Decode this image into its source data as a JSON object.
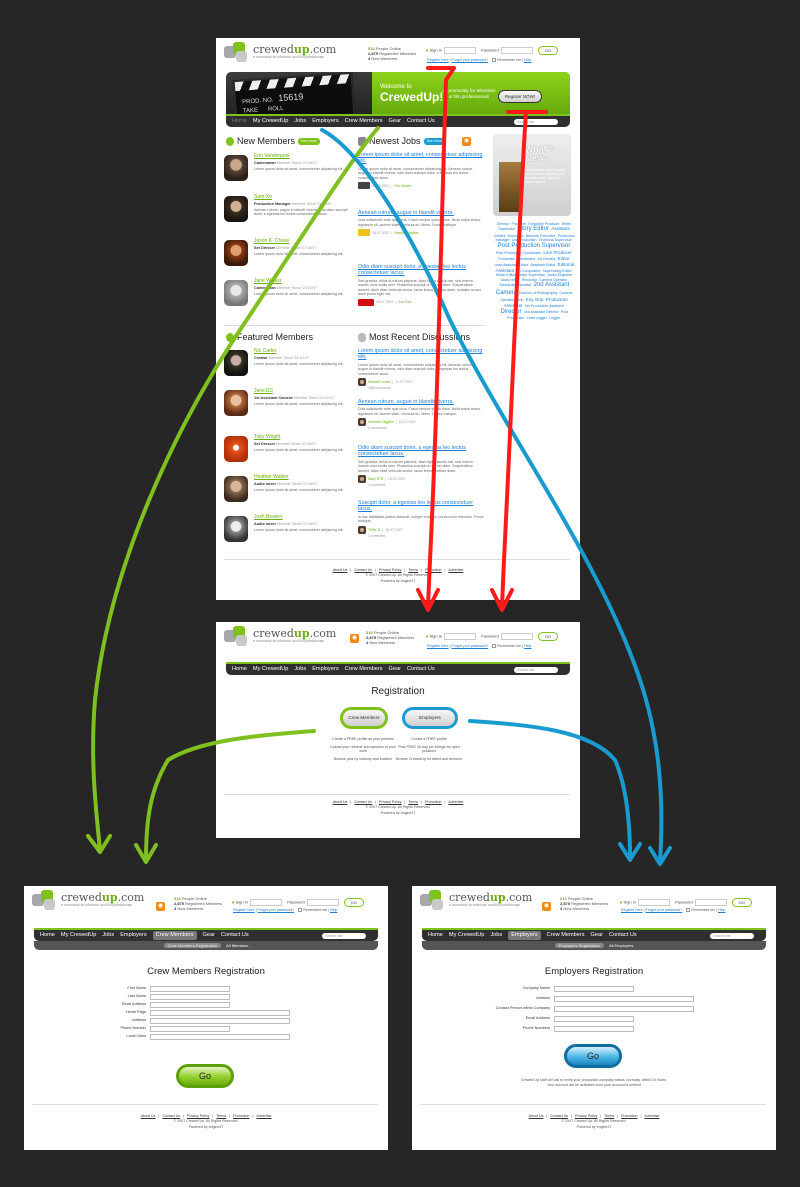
{
  "common": {
    "logo_pre": "crewed",
    "logo_mid": "up",
    "logo_post": ".com",
    "tagline": "a community for television and film professionals",
    "online_count": "516",
    "online_label": "People Online",
    "registered_count": "2,875",
    "registered_label": "Registered Members",
    "new_count": "4",
    "new_label": "New Members",
    "sign_in": "Sign In",
    "password": "Password",
    "go": "GO",
    "register_here": "Register here",
    "forgot_password": "Forgot your password?",
    "remember_me": "Remember me",
    "help": "Help",
    "search_placeholder": "Search site",
    "footer_links": [
      "About Us",
      "Contact Us",
      "Privacy Policy",
      "Terms",
      "Promotion",
      "Advertise"
    ],
    "copyright": "© 2007 Crewed Up. All Rights Reserved.",
    "powered": "Powered by engine37"
  },
  "home": {
    "nav": [
      "Home",
      "My CrewedUp",
      "Jobs",
      "Employers",
      "Crew Members",
      "Gear",
      "Contact Us"
    ],
    "banner": {
      "clap_line1": "PROD. NO.",
      "clap_line2": "TAKE",
      "clap_line3": "ROLL",
      "clap_code": "15619",
      "welcome": "Welcome to",
      "brand": "CrewedUp!",
      "community": "A community for television & film professionals",
      "register_now": "Register NOW!"
    },
    "new_members": {
      "title": "New Members",
      "see_more": "See more",
      "items": [
        {
          "name": "Erin Vanderpool",
          "role": "Cameraman",
          "since": "Member Since 07/18/07",
          "desc": "Lorem ipsum dolor sit amet, consectetuer adipiscing elit."
        },
        {
          "name": "Sam Xo",
          "role": "Production Manager",
          "since": "Member Since 07/18/07",
          "desc": "Aenean rutrum, augue in blandit viverra, odio diam suscipit dolor, a egestas leo lectus consectetuer lacus."
        },
        {
          "name": "Jason K. Chase",
          "role": "Set Dresser",
          "since": "Member Since 07/18/07",
          "desc": "Lorem ipsum dolor sit amet, consectetuer adipiscing elit."
        },
        {
          "name": "Jane Walker",
          "role": "Cameraman",
          "since": "Member Since 07/18/07",
          "desc": "Lorem ipsum dolor sit amet, consectetuer adipiscing elit."
        }
      ]
    },
    "newest_jobs": {
      "title": "Newest Jobs",
      "see_more": "See more",
      "items": [
        {
          "title": "Lorem ipsum dolor sit amet, consectetuer adipiscing elit.",
          "desc": "Lorem ipsum dolor sit amet, consectetuer adipiscing elit. Aenean rutrum, augue in blandit viverra, odio diam suscipit dolor, a egestas leo lectus consectetuer lacus.",
          "date": "06.05.2007",
          "author": "Eric Moore"
        },
        {
          "title": "Aenean rutrum, augue in blandit viverra.",
          "desc": "Duis sollicitudin ante quis urna. Fusce tempor ipsum risus. Nulla turpis lectus, dignissim sit, laoreet vitae, vehicula eu, libero. Donec tristique.",
          "date": "18.07.2007",
          "author": "Heather Walker"
        },
        {
          "title": "Odio diam suscipit dolor, a egestas leo lectus consectetuer lacus.",
          "desc": "Sed gravida, tellus id rutrum placerat, diam ligula iaculis nisi, sed viverra mauris urna mollis sem. Phasellus suscipit ut nisl vel diam. Suspendisse laoreet, diam vitae vehicula auctor, lacus lectus porttitor diam, sodales cursus diam purus eget nisi.",
          "date": "06.07.2007",
          "author": "Jon Doe"
        }
      ]
    },
    "featured_members": {
      "title": "Featured Members",
      "items": [
        {
          "name": "Nic Carter",
          "role": "Creator",
          "since": "Member Since 28.10.07",
          "desc": "Lorem ipsum dolor sit amet, consectetuer adipiscing elit."
        },
        {
          "name": "Jane113",
          "role": "1st Assistant Camera",
          "since": "Member Since 24.09.07",
          "desc": "Lorem ipsum dolor sit amet, consectetuer adipiscing elit."
        },
        {
          "name": "Toby Wright",
          "role": "Set Dresser",
          "since": "Member Since 07/18/07",
          "desc": "Lorem ipsum dolor sit amet, consectetuer adipiscing elit."
        },
        {
          "name": "Heather Walker",
          "role": "Audio mixer",
          "since": "Member Since 07/18/07",
          "desc": "Lorem ipsum dolor sit amet, consectetuer adipiscing elit."
        },
        {
          "name": "Josh Bowers",
          "role": "Audio mixer",
          "since": "Member Since 07/18/07",
          "desc": "Lorem ipsum dolor sit amet, consectetuer adipiscing elit."
        }
      ]
    },
    "discussions": {
      "title": "Most Recent Discussions",
      "items": [
        {
          "title": "Lorem ipsum dolor sit amet, consectetuer adipiscing elit.",
          "desc": "Lorem ipsum dolor sit amet, consectetuer adipiscing elit. Aenean rutrum, augue in blandit viverra, odio diam suscipit dolor, a egestas leo lectus consectetuer lacus.",
          "author": "Michael Jones",
          "date": "11.07.2007",
          "comments": "188 comments"
        },
        {
          "title": "Aenean rutrum, augue in blandit viverra.",
          "desc": "Duis sollicitudin ante quis urna. Fusce tempor ipsum risus. Nulla turpis lectus, dignissim sit, laoreet vitae, vehicula eu, libero. Donec tristique.",
          "author": "Kenneth Higgins",
          "date": "16.07.2007",
          "comments": "9 comments"
        },
        {
          "title": "Odio diam suscipit dolor, a egestas leo lectus consectetuer lacus.",
          "desc": "Sed gravida, tellus id rutrum placerat, diam ligula iaculis nisi, sed viverra mauris urna mollis sem. Phasellus suscipit ut nisl vel diam. Suspendisse laoreet, diam vitae vehicula auctor, lacus lectus porttitor diam.",
          "author": "Mary S78",
          "date": "18.07.2007",
          "comments": "1 comment"
        },
        {
          "title": "Suscipit dolor, a egestas leo lectus consectetuer lacus.",
          "desc": "In hac habitasse platea dictumst. Integer eros non purus tortor interdum. Fusce tristique.",
          "author": "TMW 3t",
          "date": "18.07.2007",
          "comments": "1 comment"
        }
      ]
    },
    "whats_new": {
      "title": "What's New?",
      "desc": "Lorem ipsum dolor sit amet, consectetuer adipiscing elit. Aenean rutrum augue in blandit viverra."
    },
    "tag_cloud": [
      {
        "t": "Director",
        "s": "s"
      },
      {
        "t": "Producer",
        "s": "s"
      },
      {
        "t": "Executive Producer",
        "s": "s"
      },
      {
        "t": "Writer",
        "s": "s"
      },
      {
        "t": "Supervisor",
        "s": "s"
      },
      {
        "t": "Story Editor",
        "s": "l"
      },
      {
        "t": "Assistant",
        "s": "m"
      },
      {
        "t": "Creator",
        "s": "s"
      },
      {
        "t": "Executive",
        "s": "s"
      },
      {
        "t": "Network Executive",
        "s": "s"
      },
      {
        "t": "Production Manager",
        "s": "s"
      },
      {
        "t": "Unit Production",
        "s": "s"
      },
      {
        "t": "Technical Supervisor",
        "s": "s"
      },
      {
        "t": "Post Production Supervisor",
        "s": "l"
      },
      {
        "t": "Post Production Coordinator",
        "s": "s"
      },
      {
        "t": "Line Producer",
        "s": "m"
      },
      {
        "t": "Production Coordinator",
        "s": "s"
      },
      {
        "t": "Art Director",
        "s": "s"
      },
      {
        "t": "Editor",
        "s": "m"
      },
      {
        "t": "Lead Assistant Editor",
        "s": "s"
      },
      {
        "t": "Assistant Editor",
        "s": "s"
      },
      {
        "t": "Editorial Assistant",
        "s": "m"
      },
      {
        "t": "2D Compositor",
        "s": "s"
      },
      {
        "t": "Supervising Editor",
        "s": "s"
      },
      {
        "t": "Music Editor",
        "s": "s"
      },
      {
        "t": "Music Supervisor",
        "s": "s"
      },
      {
        "t": "Audio Engineer",
        "s": "s"
      },
      {
        "t": "Audio mixer",
        "s": "s"
      },
      {
        "t": "Recordist",
        "s": "s"
      },
      {
        "t": "Camera Operator",
        "s": "s"
      },
      {
        "t": "Steadicam Operator",
        "s": "s"
      },
      {
        "t": "2nd Assistant Camera",
        "s": "l"
      },
      {
        "t": "Director of Photography",
        "s": "s"
      },
      {
        "t": "Camera Operator",
        "s": "s"
      },
      {
        "t": "Grip",
        "s": "s"
      },
      {
        "t": "Key Grip",
        "s": "m"
      },
      {
        "t": "Production Assistant",
        "s": "m"
      },
      {
        "t": "Set Production Assistant",
        "s": "s"
      },
      {
        "t": "Director",
        "s": "l"
      },
      {
        "t": "2nd Assistant Director",
        "s": "s"
      },
      {
        "t": "Post Production",
        "s": "s"
      },
      {
        "t": "Lead Logger",
        "s": "s"
      },
      {
        "t": "Logger",
        "s": "s"
      }
    ]
  },
  "registration": {
    "nav": [
      "Home",
      "My CrewedUp",
      "Jobs",
      "Employers",
      "Crew Members",
      "Gear",
      "Contact Us"
    ],
    "title": "Registration",
    "crew_btn": "Crew Members",
    "emp_btn": "Employers",
    "crew_desc": [
      "Create a FREE profile as your portfolio",
      "Upload your résumé and samples of your work",
      "Browse jobs by industry and location"
    ],
    "emp_desc": [
      "Create a FREE profile",
      "Post FREE 30-day job listings for open positions",
      "Browse CrewedUp for talent and services"
    ]
  },
  "crew_reg": {
    "nav": [
      "Home",
      "My CrewedUp",
      "Jobs",
      "Employers",
      "Crew Members",
      "Gear",
      "Contact Us"
    ],
    "active": "Crew Members",
    "sub": [
      "Crew Members Registration",
      "All Members"
    ],
    "title": "Crew Members Registration",
    "fields": [
      "First Name",
      "Last Name",
      "Email Address",
      "Home Page",
      "Address",
      "Phone Number",
      "Local Cities"
    ],
    "go": "Go"
  },
  "emp_reg": {
    "nav": [
      "Home",
      "My CrewedUp",
      "Jobs",
      "Employers",
      "Crew Members",
      "Gear",
      "Contact Us"
    ],
    "active": "Employers",
    "sub": [
      "Employers Registration",
      "All Employers"
    ],
    "title": "Employers Registration",
    "fields": [
      "Company Name",
      "Address",
      "Contact Person within Company",
      "Email Address",
      "Phone Numbers"
    ],
    "go": "Go",
    "note": [
      "Crewed Up staff will call to verify your production company status, normally, within 24 hours.",
      "Your account will be activated once your account is verified"
    ]
  },
  "arrow_colors": {
    "crew": "#7fbf1f",
    "employers": "#1a9bd0",
    "register": "#ff1a1a"
  }
}
